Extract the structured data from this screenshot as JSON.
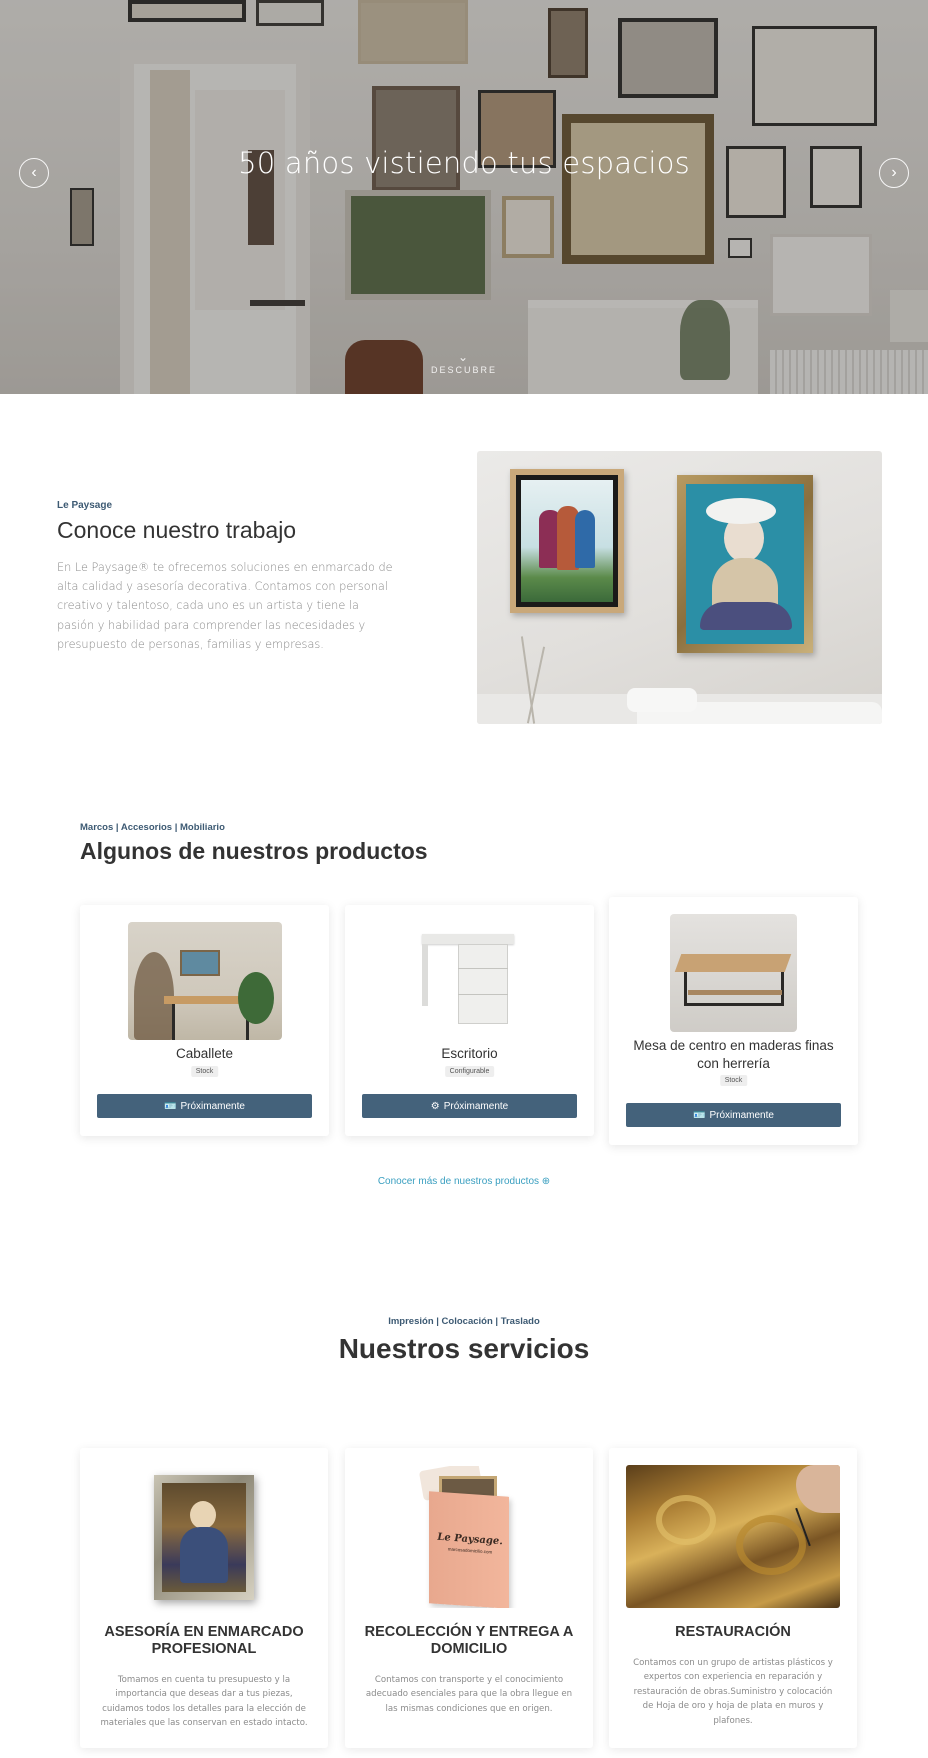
{
  "hero": {
    "title": "50 años vistiendo tus espacios",
    "prev_arrow": "‹",
    "next_arrow": "›",
    "discover_label": "DESCUBRE",
    "discover_chevron": "⌄"
  },
  "about": {
    "eyebrow": "Le Paysage",
    "title": "Conoce nuestro trabajo",
    "text": "En Le Paysage® te ofrecemos soluciones en enmarcado de alta calidad y asesoría decorativa. Contamos con personal creativo y talentoso, cada uno es un artista y tiene la pasión y habilidad para comprender las necesidades y presupuesto de personas, familias y empresas."
  },
  "products": {
    "eyebrow": "Marcos | Accesorios | Mobiliario",
    "title": "Algunos de nuestros productos",
    "items": [
      {
        "name": "Caballete",
        "badge": "Stock",
        "button": "Próximamente",
        "button_icon": "card-icon"
      },
      {
        "name": "Escritorio",
        "badge": "Configurable",
        "button": "Próximamente",
        "button_icon": "gear-icon"
      },
      {
        "name": "Mesa de centro en maderas finas con herrería",
        "badge": "Stock",
        "button": "Próximamente",
        "button_icon": "card-icon"
      }
    ],
    "more_link": "Conocer más de nuestros productos",
    "more_link_icon": "⊕"
  },
  "services": {
    "eyebrow": "Impresión | Colocación | Traslado",
    "title": "Nuestros servicios",
    "items": [
      {
        "title": "ASESORÍA EN ENMARCADO PROFESIONAL",
        "text": "Tomamos en cuenta tu presupuesto y la importancia que deseas dar a tus piezas, cuidamos todos los detalles para la elección de materiales que las conservan en estado intacto."
      },
      {
        "title": "RECOLECCIÓN Y ENTREGA A DOMICILIO",
        "text": "Contamos con transporte y el conocimiento adecuado esenciales para que la obra llegue en las mismas condiciones que en origen.",
        "box_brand": "Le Paysage.",
        "box_sub": "marcosadomicilio.com"
      },
      {
        "title": "RESTAURACIÓN",
        "text": "Contamos con un grupo de artistas plásticos y expertos con experiencia en reparación y restauración de obras.Suministro y colocación de Hoja de oro y hoja de plata en muros y plafones."
      }
    ]
  },
  "colors": {
    "accent": "#44627b",
    "eyebrow": "#3d5a73",
    "link": "#3a9fc0"
  }
}
